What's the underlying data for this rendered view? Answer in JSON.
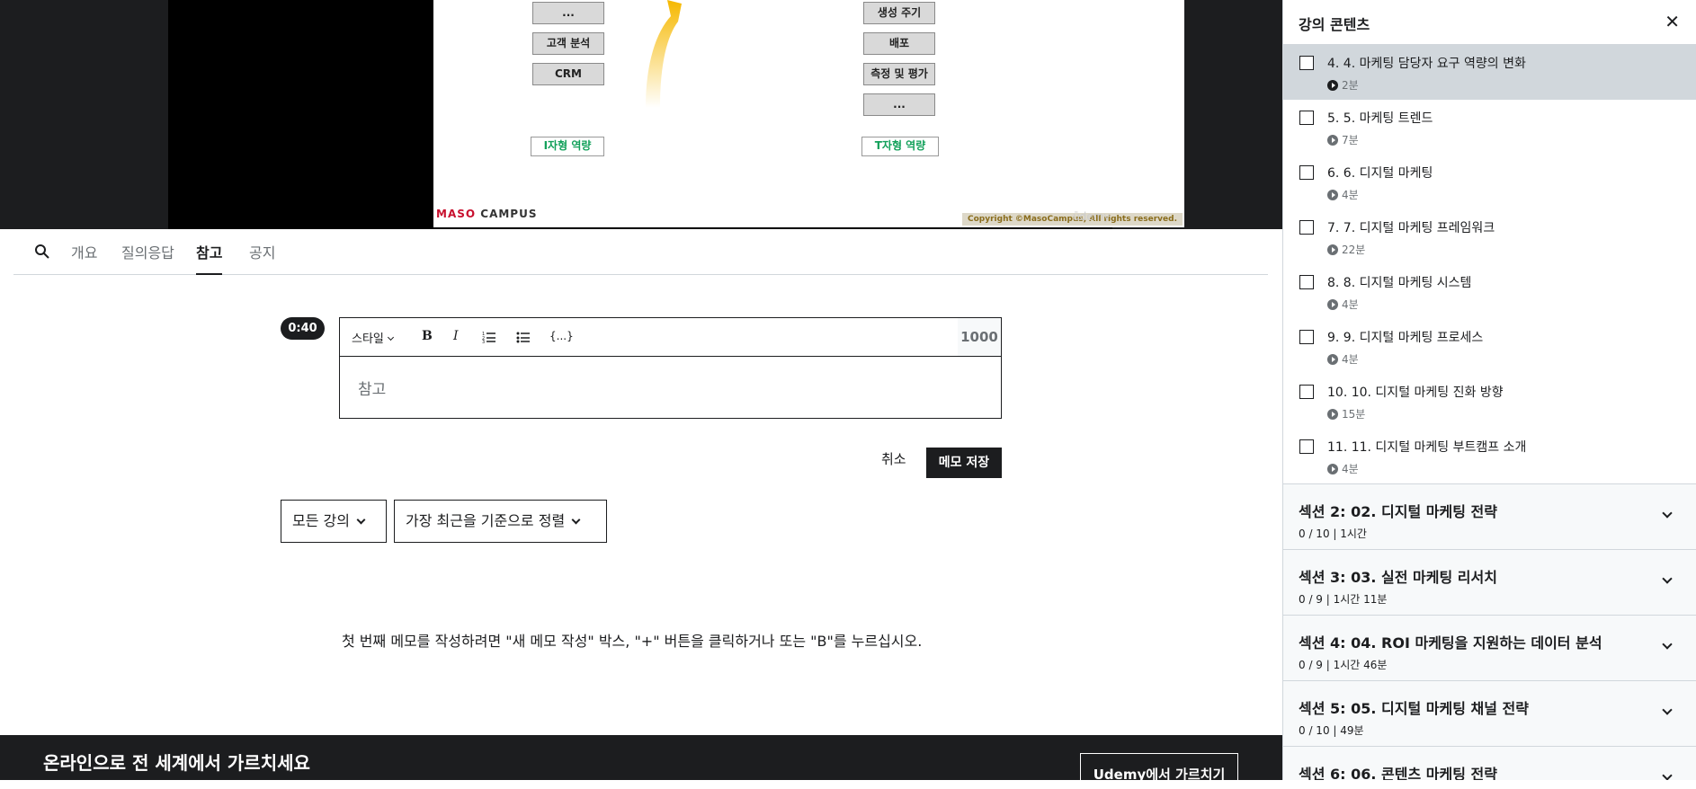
{
  "slide": {
    "left_boxes": [
      "...",
      "고객 분석",
      "CRM"
    ],
    "right_boxes": [
      "생성 주기",
      "배포",
      "측정 및 평가",
      "..."
    ],
    "left_label": "I자형 역량",
    "right_label": "T자형 역량",
    "brand_red": "MASO",
    "brand_dark": "CAMPUS",
    "copyright": "Copyright ©MasoCampus, All rights reserved.",
    "watermark": "ūdemy"
  },
  "tabs": {
    "search_icon": "search-icon",
    "items": [
      "개요",
      "질의응답",
      "참고",
      "공지"
    ],
    "active": "참고"
  },
  "editor": {
    "timestamp": "0:40",
    "style_label": "스타일",
    "bold": "B",
    "italic": "I",
    "code": "{...}",
    "char_count": "1000",
    "body": "참고"
  },
  "actions": {
    "cancel": "취소",
    "save": "메모 저장"
  },
  "filters": {
    "scope": "모든 강의",
    "sort": "가장 최근을 기준으로 정렬"
  },
  "empty_message": "첫 번째 메모를 작성하려면 \"새 메모 작성\" 박스, \"+\" 버튼을 클릭하거나 또는 \"B\"를 누르십시오.",
  "footer": {
    "title": "온라인으로 전 세계에서 가르치세요",
    "button": "Udemy에서 가르치기"
  },
  "sidebar": {
    "title": "강의 콘텐츠",
    "close": "✕",
    "lectures": [
      {
        "title": "4. 4. 마케팅 담당자 요구 역량의 변화",
        "duration": "2분",
        "active": true
      },
      {
        "title": "5. 5. 마케팅 트렌드",
        "duration": "7분"
      },
      {
        "title": "6. 6. 디지털 마케팅",
        "duration": "4분"
      },
      {
        "title": "7. 7. 디지털 마케팅 프레임워크",
        "duration": "22분"
      },
      {
        "title": "8. 8. 디지털 마케팅 시스템",
        "duration": "4분"
      },
      {
        "title": "9. 9. 디지털 마케팅 프로세스",
        "duration": "4분"
      },
      {
        "title": "10. 10. 디지털 마케팅 진화 방향",
        "duration": "15분"
      },
      {
        "title": "11. 11. 디지털 마케팅 부트캠프 소개",
        "duration": "4분"
      }
    ],
    "sections": [
      {
        "title": "섹션 2: 02. 디지털 마케팅 전략",
        "meta": "0 / 10 | 1시간"
      },
      {
        "title": "섹션 3: 03. 실전 마케팅 리서치",
        "meta": "0 / 9 | 1시간 11분"
      },
      {
        "title": "섹션 4: 04. ROI 마케팅을 지원하는 데이터 분석",
        "meta": "0 / 9 | 1시간 46분"
      },
      {
        "title": "섹션 5: 05. 디지털 마케팅 채널 전략",
        "meta": "0 / 10 | 49분"
      },
      {
        "title": "섹션 6: 06. 콘텐츠 마케팅 전략",
        "meta": ""
      }
    ]
  },
  "colors": {
    "dark": "#1c1d1f",
    "border": "#d1d7dc",
    "active_bg": "#d1d7dc",
    "green": "#12a05a",
    "red": "#c8102e"
  }
}
